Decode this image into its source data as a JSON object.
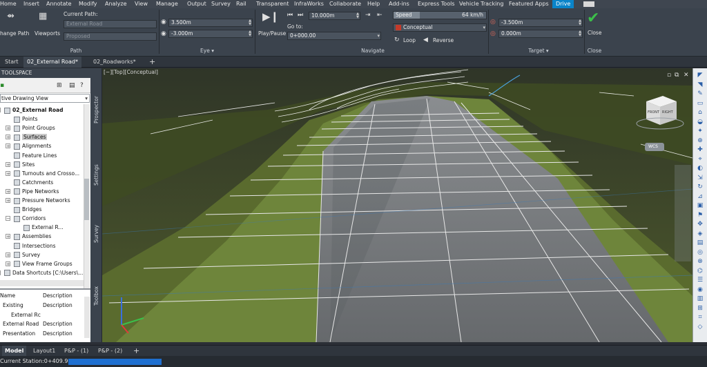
{
  "menu": [
    "Home",
    "Insert",
    "Annotate",
    "Modify",
    "Analyze",
    "View",
    "Manage",
    "Output",
    "Survey",
    "Rail",
    "Transparent",
    "InfraWorks",
    "Collaborate",
    "Help",
    "Add-ins",
    "Express Tools",
    "Vehicle Tracking",
    "Featured Apps",
    "Drive"
  ],
  "active_menu": "Drive",
  "ribbon": {
    "path": {
      "change_path": "hange Path",
      "viewports": "Viewports",
      "current_path_label": "Current Path:",
      "current_path_value": "External Road",
      "proposed": "Proposed",
      "title": "Path"
    },
    "eye": {
      "height": "3.500m",
      "offset": "-3.000m",
      "title": "Eye ▾"
    },
    "navigate": {
      "play_pause": "Play/Pause",
      "distance": "10.000m",
      "goto_label": "Go to:",
      "station": "0+000.00",
      "title": "Navigate"
    },
    "visual": {
      "speed_label": "Speed",
      "speed_value": "64 km/h",
      "style": "Conceptual",
      "loop": "Loop",
      "reverse": "Reverse"
    },
    "target": {
      "offset": "-3.500m",
      "height": "0.000m",
      "title": "Target ▾"
    },
    "close": {
      "label": "Close",
      "title": "Close"
    }
  },
  "doc_tabs": {
    "start": "Start",
    "tab1": "02_External Road*",
    "tab2": "02_Roadworks*",
    "add": "+"
  },
  "toolspace": {
    "title": "TOOLSPACE",
    "view_select": "tive Drawing View",
    "tree": [
      {
        "label": "02_External Road",
        "bold": true
      },
      {
        "label": "Points"
      },
      {
        "label": "Point Groups"
      },
      {
        "label": "Surfaces",
        "selected": true
      },
      {
        "label": "Alignments"
      },
      {
        "label": "Feature Lines"
      },
      {
        "label": "Sites"
      },
      {
        "label": "Turnouts and Crosso..."
      },
      {
        "label": "Catchments"
      },
      {
        "label": "Pipe Networks"
      },
      {
        "label": "Pressure Networks"
      },
      {
        "label": "Bridges"
      },
      {
        "label": "Corridors"
      },
      {
        "label": "External R..."
      },
      {
        "label": "Assemblies"
      },
      {
        "label": "Intersections"
      },
      {
        "label": "Survey"
      },
      {
        "label": "View Frame Groups"
      },
      {
        "label": "Data Shortcuts [C:\\Users\\..."
      }
    ],
    "list_headers": [
      "Name",
      "Description"
    ],
    "list_rows": [
      [
        "Existing",
        "Description"
      ],
      [
        "External Rc",
        ""
      ],
      [
        "External Road",
        "Description"
      ],
      [
        "Presentation",
        "Description"
      ]
    ]
  },
  "side_tabs": [
    "Prospector",
    "Settings",
    "Survey",
    "Toolbox"
  ],
  "viewport": {
    "label": "[−][Top][Conceptual]",
    "cube_front": "FRONT",
    "cube_right": "RIGHT",
    "wcs": "WCS"
  },
  "layout_tabs": {
    "model": "Model",
    "layout1": "Layout1",
    "pp1": "P&P - (1)",
    "pp2": "P&P - (2)",
    "add": "+"
  },
  "status": {
    "text": "Current Station:0+409.90m"
  },
  "colors": {
    "ribbon_bg": "#3b434d",
    "accent": "#0a84c9",
    "terrain": "#4e5a2b",
    "road": "#6f7377"
  }
}
